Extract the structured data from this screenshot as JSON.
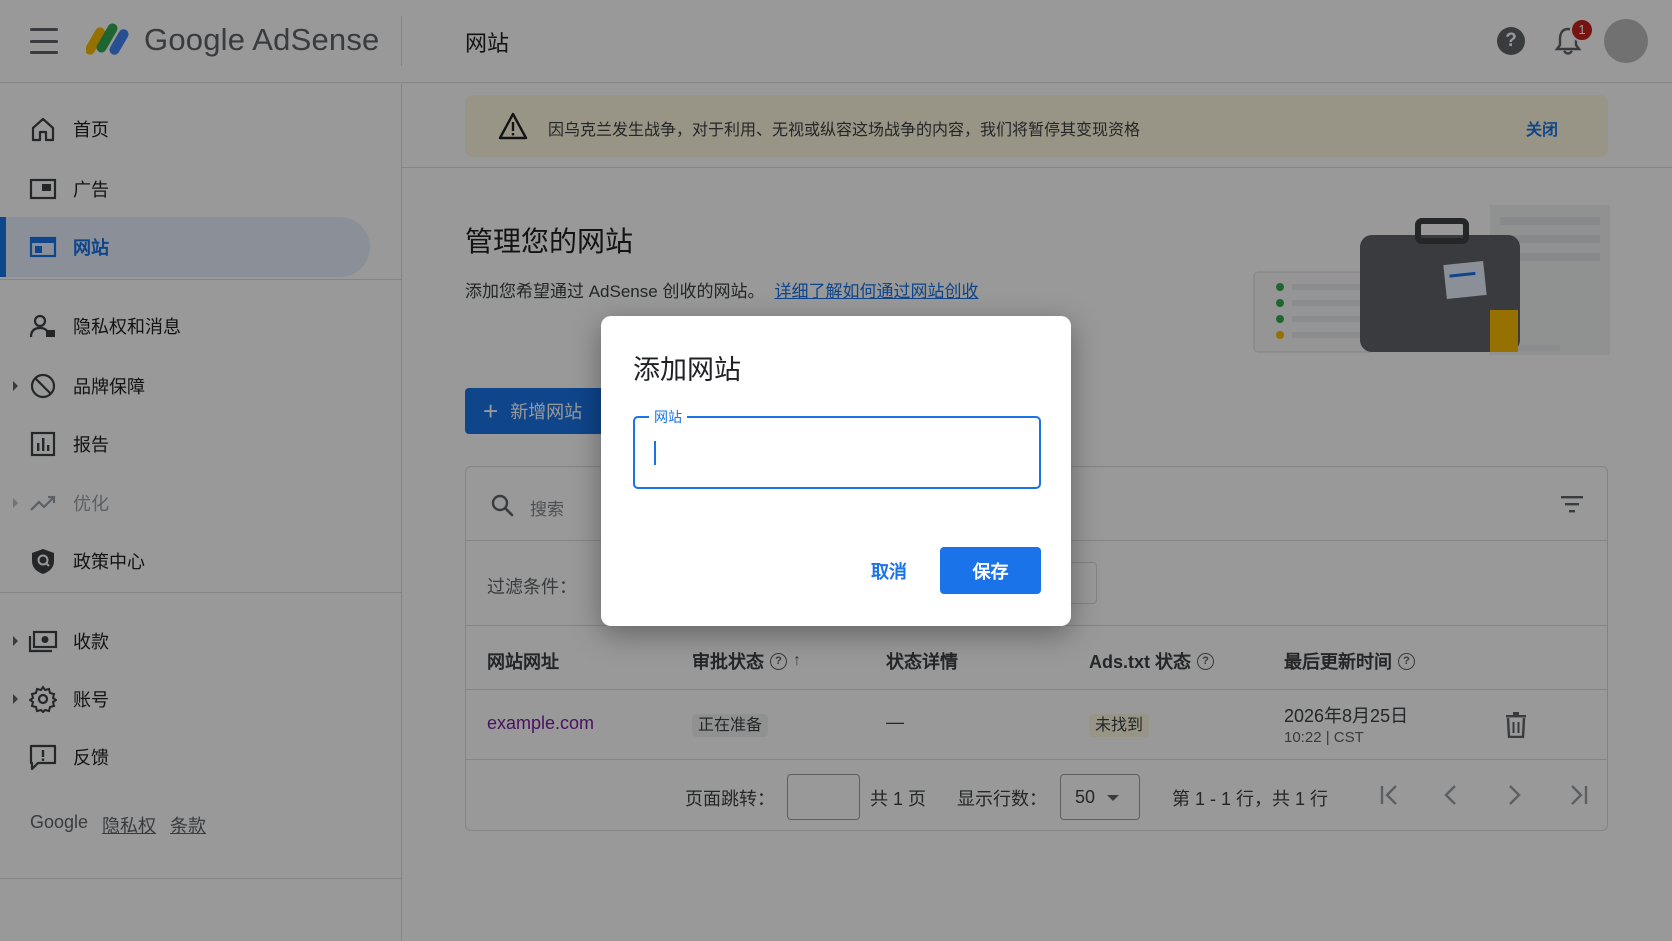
{
  "header": {
    "logo_text": "Google AdSense",
    "page_title": "网站",
    "notification_count": "1"
  },
  "sidebar": {
    "items": [
      {
        "label": "首页",
        "icon": "home-icon"
      },
      {
        "label": "广告",
        "icon": "ads-icon"
      },
      {
        "label": "网站",
        "icon": "sites-icon",
        "active": true
      },
      {
        "label": "隐私权和消息",
        "icon": "privacy-icon"
      },
      {
        "label": "品牌保障",
        "icon": "block-icon"
      },
      {
        "label": "报告",
        "icon": "report-icon"
      },
      {
        "label": "优化",
        "icon": "trending-icon",
        "disabled": true
      },
      {
        "label": "政策中心",
        "icon": "shield-icon"
      },
      {
        "label": "收款",
        "icon": "payments-icon"
      },
      {
        "label": "账号",
        "icon": "gear-icon"
      },
      {
        "label": "反馈",
        "icon": "feedback-icon"
      }
    ],
    "footer": {
      "brand": "Google",
      "privacy": "隐私权",
      "terms": "条款"
    }
  },
  "banner": {
    "text": "因乌克兰发生战争，对于利用、无视或纵容这场战争的内容，我们将暂停其变现资格",
    "close_label": "关闭"
  },
  "main": {
    "title": "管理您的网站",
    "description": "添加您希望通过 AdSense 创收的网站。",
    "learn_more": "详细了解如何通过网站创收",
    "add_button": "新增网站"
  },
  "table": {
    "search_placeholder": "搜索",
    "filter_label": "过滤条件：",
    "columns": [
      "网站网址",
      "审批状态",
      "状态详情",
      "Ads.txt 状态",
      "最后更新时间"
    ],
    "rows": [
      {
        "site": "example.com",
        "approval": "正在准备",
        "details": "—",
        "ads_txt": "未找到",
        "updated_date": "2026年8月25日",
        "updated_time": "10:22 | CST"
      }
    ],
    "pager": {
      "jump_label": "页面跳转：",
      "total_pages": "共 1 页",
      "rows_label": "显示行数：",
      "rows_value": "50",
      "range": "第 1 - 1 行，共 1 行"
    }
  },
  "dialog": {
    "title": "添加网站",
    "field_label": "网站",
    "field_value": "",
    "cancel_label": "取消",
    "save_label": "保存"
  },
  "colors": {
    "accent": "#1a73e8",
    "banner_bg": "#fef7e0",
    "link_visited": "#7b1fa2"
  }
}
